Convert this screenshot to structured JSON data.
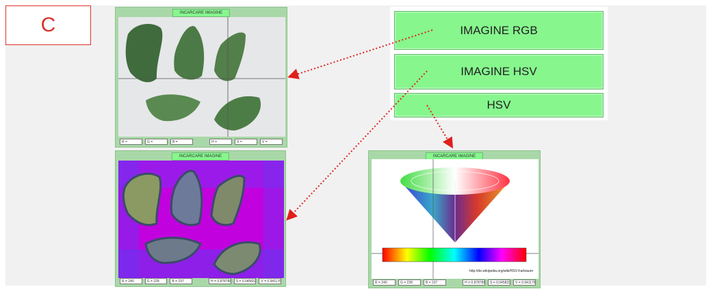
{
  "label": "C",
  "buttons": {
    "rgb": "IMAGINE RGB",
    "hsv": "IMAGINE HSV",
    "hsv_cone": "HSV"
  },
  "panels": {
    "rgb": {
      "title": "INCARCARE IMAGINE",
      "readouts": [
        "R =",
        "G =",
        "B =",
        "H =",
        "S =",
        "V ="
      ]
    },
    "hsv": {
      "title": "INCARCARE IMAGINE",
      "readouts": [
        "R = 240",
        "G = 228",
        "B = 237",
        "H = 0.878788",
        "S = 0.0458333",
        "V = 0.941176"
      ]
    },
    "cone": {
      "title": "INCARCARE IMAGINE",
      "url": "http://de.wikipedia.org/wiki/HSV-Farbraum",
      "readouts": [
        "R = 240",
        "G = 228",
        "B = 237",
        "H = 0.878788",
        "S = 0.0458333",
        "V = 0.941176"
      ]
    }
  },
  "colors": {
    "button_green": "#86f68d",
    "panel_green": "#a9d8a8",
    "arrow_red": "#e0201b",
    "hsv_bg": "#c100de"
  }
}
